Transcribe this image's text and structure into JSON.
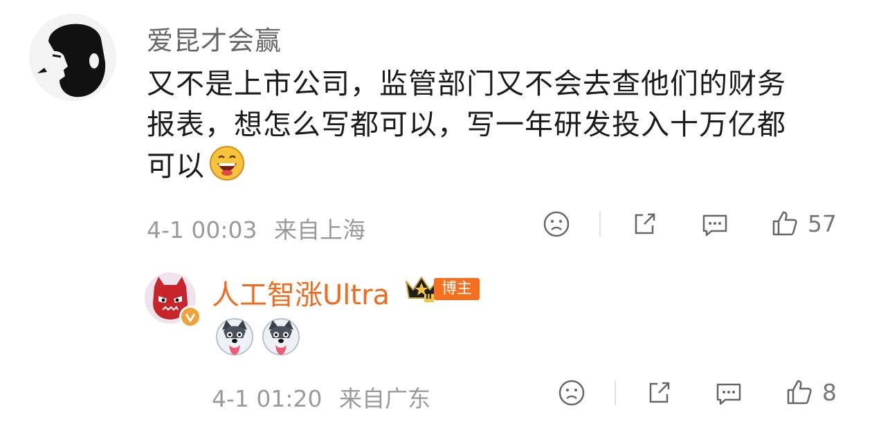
{
  "comment": {
    "author": "爱昆才会赢",
    "text_line1": "又不是上市公司，监管部门又不会去查他们的财务",
    "text_line2": "报表，想怎么写都可以，写一年研发投入十万亿都",
    "text_line3": "可以",
    "emoji_icon": "grinning-face-icon",
    "time": "4-1 00:03",
    "location": "来自上海",
    "like_count": "57"
  },
  "reply": {
    "author": "人工智涨Ultra",
    "badge_label": "博主",
    "crown_level": "II",
    "stickers": [
      "husky-icon",
      "husky-icon"
    ],
    "time": "4-1 01:20",
    "location": "来自广东",
    "like_count": "8"
  },
  "colors": {
    "reply_name": "#ef6b1e",
    "badge_bg": "#f56f1f",
    "meta_text": "#9a9a9a"
  }
}
